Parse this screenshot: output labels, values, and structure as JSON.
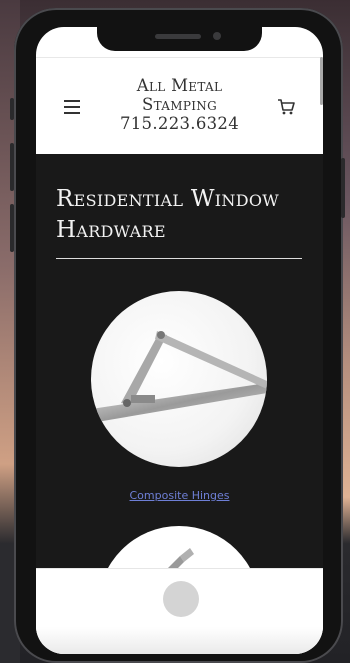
{
  "brand": {
    "line1": "All Metal",
    "line2": "Stamping",
    "phone": "715.223.6324"
  },
  "page": {
    "title": "Residential Window Hardware"
  },
  "products": [
    {
      "label": "Composite Hinges"
    }
  ],
  "icons": {
    "menu": "hamburger-menu-icon",
    "cart": "shopping-cart-icon"
  },
  "colors": {
    "content_bg": "#191919",
    "link": "#6e7fd6",
    "title": "#f2f2f2"
  }
}
